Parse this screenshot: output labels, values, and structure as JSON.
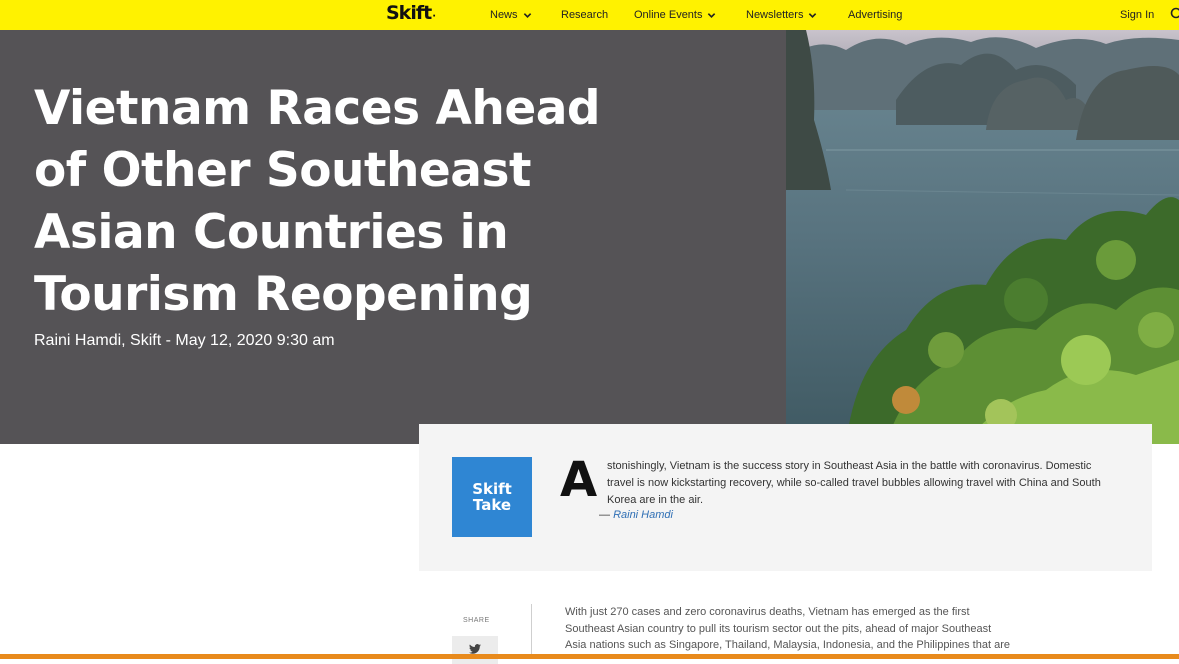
{
  "nav": {
    "logo": "Skift",
    "items": [
      {
        "label": "News",
        "dropdown": true
      },
      {
        "label": "Research",
        "dropdown": false
      },
      {
        "label": "Online Events",
        "dropdown": true
      },
      {
        "label": "Newsletters",
        "dropdown": true
      },
      {
        "label": "Advertising",
        "dropdown": false
      }
    ],
    "signin": "Sign In",
    "bar_color": "#fff200"
  },
  "hero": {
    "title": "Vietnam Races Ahead of Other Southeast Asian Countries in Tourism Reopening",
    "byline": "Raini Hamdi, Skift - May 12, 2020 9:30 am"
  },
  "skift_take": {
    "badge_line1": "Skift",
    "badge_line2": "Take",
    "dropcap": "A",
    "text": "stonishingly, Vietnam is the success story in Southeast Asia in the battle with coronavirus. Domestic travel is now kickstarting recovery, while so-called travel bubbles allowing travel with China and South Korea are in the air.",
    "author_prefix": "— ",
    "author": "Raini Hamdi"
  },
  "article": {
    "share_label": "SHARE",
    "first_paragraph": "With just 270 cases and zero coronavirus deaths, Vietnam has emerged as the first Southeast Asian country to pull its tourism sector out the pits, ahead of major Southeast Asia nations such as Singapore, Thailand, Malaysia, Indonesia, and the Philippines that are"
  },
  "colors": {
    "accent_yellow": "#fff200",
    "hero_gray": "#555356",
    "badge_blue": "#2f86d3",
    "bottom_orange": "#e88a1c"
  }
}
